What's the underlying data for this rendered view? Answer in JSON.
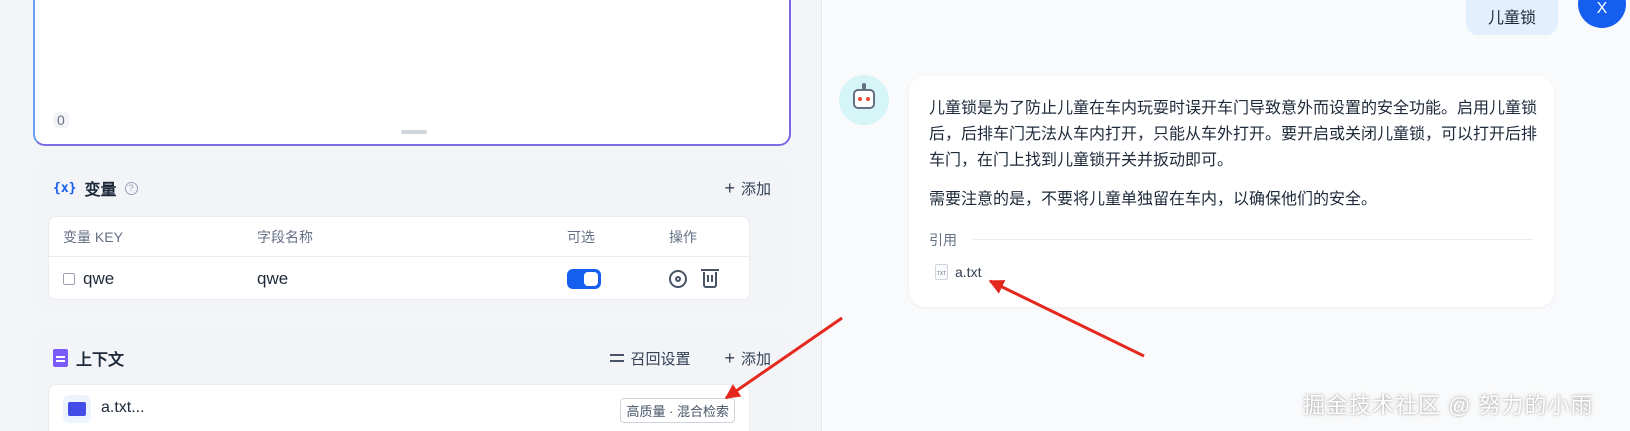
{
  "prompt_editor": {
    "char_count": "0"
  },
  "variables": {
    "title": "变量",
    "help": "?",
    "add_label": "添加",
    "columns": [
      "变量 KEY",
      "字段名称",
      "可选",
      "操作"
    ],
    "rows": [
      {
        "key": "qwe",
        "name": "qwe",
        "optional": true
      }
    ]
  },
  "context": {
    "title": "上下文",
    "recall_label": "召回设置",
    "add_label": "添加",
    "dataset": {
      "name": "a.txt...",
      "badge": "高质量 · 混合检索"
    }
  },
  "chat": {
    "user_message": "儿童锁",
    "user_avatar": "X",
    "answer_paragraphs": [
      "儿童锁是为了防止儿童在车内玩耍时误开车门导致意外而设置的安全功能。启用儿童锁后，后排车门无法从车内打开，只能从车外打开。要开启或关闭儿童锁，可以打开后排车门，在门上找到儿童锁开关并扳动即可。",
      "需要注意的是，不要将儿童单独留在车内，以确保他们的安全。"
    ],
    "citation_label": "引用",
    "citation_file": "a.txt",
    "citation_file_ext": "TXT"
  },
  "watermark": "掘金技术社区 @ 努力的小雨",
  "colors": {
    "accent": "#155eef",
    "arrow": "#e5281e",
    "context_icon": "#7a5af8",
    "bot_bg": "#d5f5f6"
  }
}
